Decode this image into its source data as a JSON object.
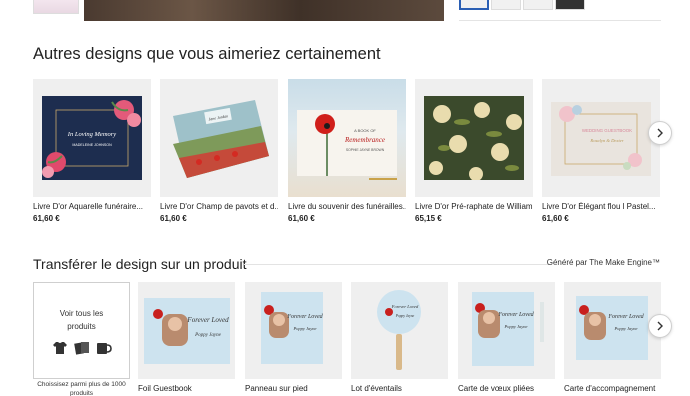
{
  "section1": {
    "title": "Autres designs que vous aimeriez certainement",
    "products": [
      {
        "name": "Livre D'or Aquarelle funéraire...",
        "price": "61,60 €",
        "cover_title": "In Loving Memory",
        "cover_name": "MADELEINE JOHNSON"
      },
      {
        "name": "Livre D'or Champ de pavots et d...",
        "price": "61,60 €",
        "cover_title": "Jane Jordan"
      },
      {
        "name": "Livre du souvenir des funérailles...",
        "price": "61,60 €",
        "cover_small": "A BOOK OF",
        "cover_title": "Remembrance",
        "cover_name": "SOPHIE JAYNE BROWN"
      },
      {
        "name": "Livre D'or Pré-raphate de William...",
        "price": "65,15 €"
      },
      {
        "name": "Livre D'or Élégant flou l Pastel...",
        "price": "61,60 €",
        "cover_title": "WEDDING GUESTBOOK",
        "cover_name": "Rosalyn & Dexter"
      }
    ]
  },
  "section2": {
    "title": "Transférer le design sur un produit",
    "engine_note": "Généré par The Make Engine™",
    "see_all": {
      "line1": "Voir tous les",
      "line2": "produits",
      "caption_line1": "Choissisez parmi plus de 1000",
      "caption_line2": "produits"
    },
    "tiles": [
      {
        "name": "Foil Guestbook",
        "art_title": "Forever Loved",
        "art_name": "Poppy Jayne"
      },
      {
        "name": "Panneau sur pied",
        "art_title": "Forever Loved",
        "art_name": "Poppy Jayne"
      },
      {
        "name": "Lot d'éventails",
        "art_title": "Forever Loved",
        "art_name": "Poppy Jayne"
      },
      {
        "name": "Carte de vœux pliées",
        "art_title": "Forever Loved",
        "art_name": "Poppy Jayne"
      },
      {
        "name": "Carte d'accompagnement",
        "art_title": "Forever Loved",
        "art_name": "Poppy Jayne"
      }
    ]
  },
  "colors": {
    "accent": "#2b5fb4",
    "navy": "#1d2d4f",
    "light_blue": "#cde3ef",
    "poppy_red": "#c8201e"
  }
}
